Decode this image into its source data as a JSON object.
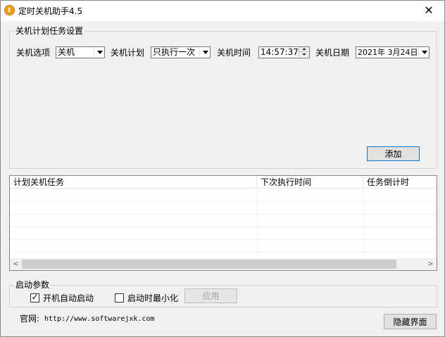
{
  "window": {
    "title": "定时关机助手4.5",
    "close_glyph": "✕"
  },
  "settings_group": {
    "legend": "关机计划任务设置",
    "option_label": "关机选项",
    "option_value": "关机",
    "plan_label": "关机计划",
    "plan_value": "只执行一次",
    "time_label": "关机时间",
    "time_value": "14:57:37",
    "date_label": "关机日期",
    "date_value": "2021年 3月24日",
    "add_button": "添加"
  },
  "task_list": {
    "columns": [
      "计划关机任务",
      "下次执行时间",
      "任务倒计时"
    ],
    "rows": []
  },
  "startup_group": {
    "legend": "启动参数",
    "autostart_label": "开机自动启动",
    "autostart_checked": true,
    "minimize_label": "启动时最小化",
    "minimize_checked": false,
    "apply_button": "应用"
  },
  "footer": {
    "website_label": "官网:",
    "website_url": "http://www.softwarejxk.com",
    "hide_button": "隐藏界面"
  },
  "icons": {
    "check_glyph": "✓",
    "scroll_left": "<",
    "scroll_right": ">"
  }
}
